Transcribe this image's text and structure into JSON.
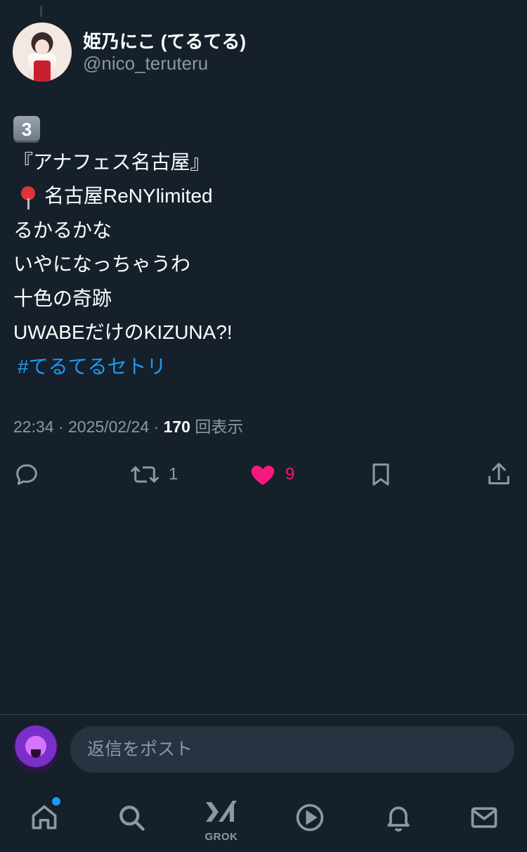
{
  "author": {
    "display_name": "姫乃にこ (てるてる)",
    "handle": "@nico_teruteru"
  },
  "post": {
    "lines": [
      {
        "emoji": "keycap-3",
        "keycap_text": "3",
        "text": ""
      },
      {
        "text": "『アナフェス名古屋』"
      },
      {
        "emoji": "round-pushpin",
        "text": "名古屋ReNYlimited"
      },
      {
        "text": "るかるかな"
      },
      {
        "text": "いやになっちゃうわ"
      },
      {
        "text": "十色の奇跡"
      },
      {
        "text": "UWABEだけのKIZUNA?!"
      }
    ],
    "hashtag": "#てるてるセトリ",
    "time": "22:34",
    "date": "2025/02/24",
    "separator": " · ",
    "view_count": "170",
    "view_label": "回表示"
  },
  "actions": {
    "reply": {
      "icon": "reply-icon"
    },
    "repost": {
      "icon": "repost-icon",
      "count": "1"
    },
    "like": {
      "icon": "heart-icon",
      "count": "9",
      "liked": true,
      "color": "#f91880"
    },
    "bookmark": {
      "icon": "bookmark-icon"
    },
    "share": {
      "icon": "share-icon"
    }
  },
  "reply_bar": {
    "placeholder": "返信をポスト"
  },
  "tabbar": {
    "items": [
      {
        "icon": "home-icon",
        "has_notification_dot": true
      },
      {
        "icon": "search-icon"
      },
      {
        "icon": "grok-icon",
        "label": "GROK"
      },
      {
        "icon": "video-play-icon"
      },
      {
        "icon": "bell-icon"
      },
      {
        "icon": "mail-icon"
      }
    ]
  },
  "theme": {
    "background": "#15202b",
    "accent": "#1d9bf0",
    "like": "#f91880",
    "secondary_text": "#8b98a5"
  }
}
